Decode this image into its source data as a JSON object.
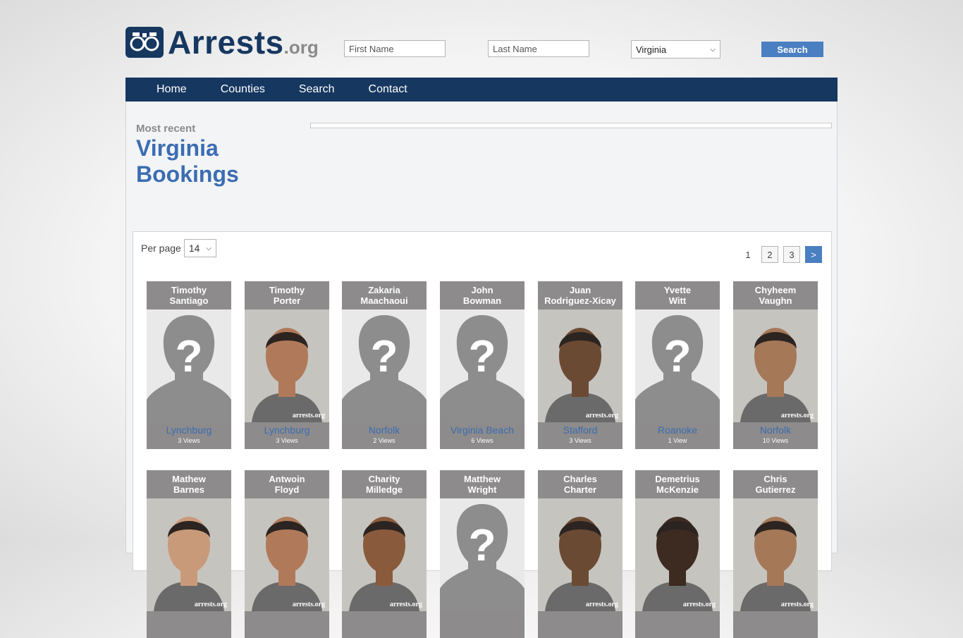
{
  "logo": {
    "main": "Arrests",
    "ext": ".org"
  },
  "search": {
    "first_placeholder": "First Name",
    "last_placeholder": "Last Name",
    "state": "Virginia",
    "button": "Search"
  },
  "nav": [
    "Home",
    "Counties",
    "Search",
    "Contact"
  ],
  "heading": {
    "kicker": "Most recent",
    "title_line1": "Virginia",
    "title_line2": "Bookings"
  },
  "list": {
    "per_page_label": "Per page",
    "per_page_value": "14",
    "pages": [
      "1",
      "2",
      "3",
      ">"
    ]
  },
  "watermark": "arrests.org",
  "bookings": [
    {
      "first": "Timothy",
      "last": "Santiago",
      "location": "Lynchburg",
      "views": "3 Views",
      "photo": "placeholder"
    },
    {
      "first": "Timothy",
      "last": "Porter",
      "location": "Lynchburg",
      "views": "3 Views",
      "photo": "mugshot"
    },
    {
      "first": "Zakaria",
      "last": "Maachaoui",
      "location": "Norfolk",
      "views": "2 Views",
      "photo": "placeholder"
    },
    {
      "first": "John",
      "last": "Bowman",
      "location": "Virginia Beach",
      "views": "6 Views",
      "photo": "placeholder"
    },
    {
      "first": "Juan",
      "last": "Rodriguez-Xicay",
      "location": "Stafford",
      "views": "3 Views",
      "photo": "mugshot"
    },
    {
      "first": "Yvette",
      "last": "Witt",
      "location": "Roanoke",
      "views": "1 View",
      "photo": "placeholder"
    },
    {
      "first": "Chyheem",
      "last": "Vaughn",
      "location": "Norfolk",
      "views": "10 Views",
      "photo": "mugshot"
    },
    {
      "first": "Mathew",
      "last": "Barnes",
      "location": "",
      "views": "",
      "photo": "mugshot"
    },
    {
      "first": "Antwoin",
      "last": "Floyd",
      "location": "",
      "views": "",
      "photo": "mugshot"
    },
    {
      "first": "Charity",
      "last": "Milledge",
      "location": "",
      "views": "",
      "photo": "mugshot"
    },
    {
      "first": "Matthew",
      "last": "Wright",
      "location": "",
      "views": "",
      "photo": "placeholder"
    },
    {
      "first": "Charles",
      "last": "Charter",
      "location": "",
      "views": "",
      "photo": "mugshot"
    },
    {
      "first": "Demetrius",
      "last": "McKenzie",
      "location": "",
      "views": "",
      "photo": "mugshot"
    },
    {
      "first": "Chris",
      "last": "Gutierrez",
      "location": "",
      "views": "",
      "photo": "mugshot"
    }
  ],
  "colors": {
    "navy": "#163760",
    "accent": "#4a7fc1",
    "link": "#3b6db2",
    "card": "#8d8b8b"
  }
}
